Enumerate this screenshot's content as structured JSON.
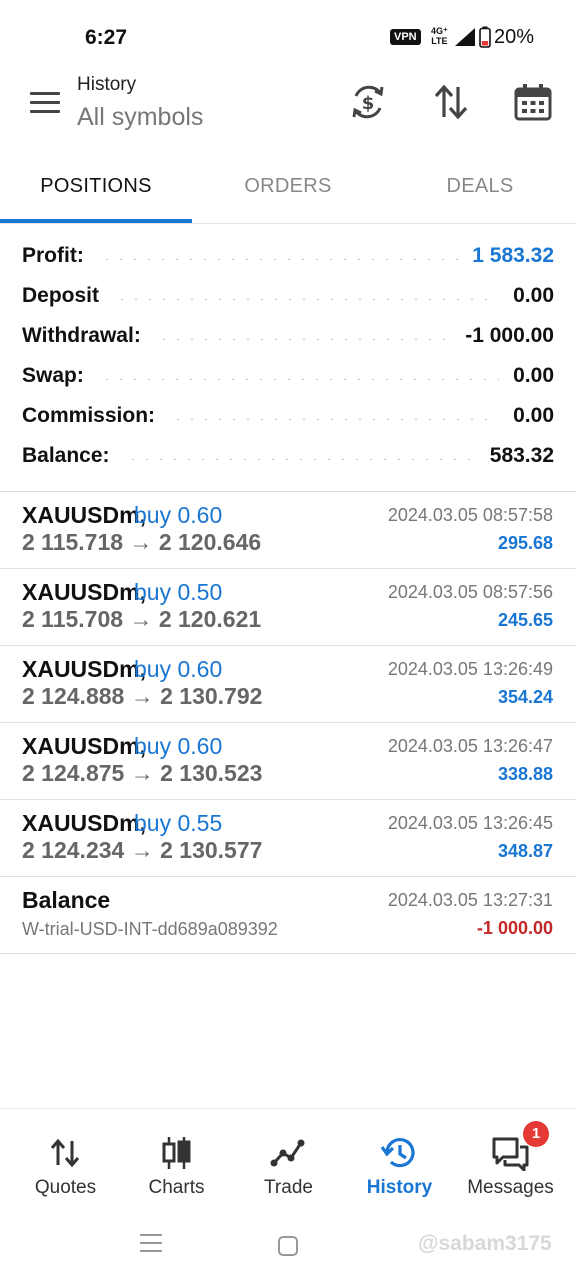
{
  "status_bar": {
    "time": "6:27",
    "vpn": "VPN",
    "network_top": "4G⁺",
    "network_bottom": "LTE",
    "battery": "20%"
  },
  "header": {
    "title": "History",
    "subtitle": "All symbols",
    "icons": [
      "currency-refresh-icon",
      "sort-icon",
      "calendar-icon"
    ]
  },
  "tabs": [
    {
      "label": "POSITIONS",
      "active": true
    },
    {
      "label": "ORDERS",
      "active": false
    },
    {
      "label": "DEALS",
      "active": false
    }
  ],
  "summary": {
    "profit": {
      "label": "Profit:",
      "value": "1 583.32"
    },
    "deposit": {
      "label": "Deposit",
      "value": "0.00"
    },
    "withdrawal": {
      "label": "Withdrawal:",
      "value": "-1 000.00"
    },
    "swap": {
      "label": "Swap:",
      "value": "0.00"
    },
    "commission": {
      "label": "Commission:",
      "value": "0.00"
    },
    "balance": {
      "label": "Balance:",
      "value": "583.32"
    }
  },
  "deals": [
    {
      "symbol": "XAUUSDm,",
      "side": "buy 0.60",
      "prices": "2 115.718 → 2 120.646",
      "time": "2024.03.05 08:57:58",
      "profit": "295.68"
    },
    {
      "symbol": "XAUUSDm,",
      "side": "buy 0.50",
      "prices": "2 115.708 → 2 120.621",
      "time": "2024.03.05 08:57:56",
      "profit": "245.65"
    },
    {
      "symbol": "XAUUSDm,",
      "side": "buy 0.60",
      "prices": "2 124.888 → 2 130.792",
      "time": "2024.03.05 13:26:49",
      "profit": "354.24"
    },
    {
      "symbol": "XAUUSDm,",
      "side": "buy 0.60",
      "prices": "2 124.875 → 2 130.523",
      "time": "2024.03.05 13:26:47",
      "profit": "338.88"
    },
    {
      "symbol": "XAUUSDm,",
      "side": "buy 0.55",
      "prices": "2 124.234 → 2 130.577",
      "time": "2024.03.05 13:26:45",
      "profit": "348.87"
    }
  ],
  "balance_entry": {
    "title": "Balance",
    "comment": "W-trial-USD-INT-dd689a089392",
    "time": "2024.03.05 13:27:31",
    "amount": "-1 000.00"
  },
  "bottom_nav": [
    {
      "label": "Quotes",
      "icon": "quotes-icon",
      "active": false
    },
    {
      "label": "Charts",
      "icon": "charts-icon",
      "active": false
    },
    {
      "label": "Trade",
      "icon": "trade-icon",
      "active": false
    },
    {
      "label": "History",
      "icon": "history-icon",
      "active": true
    },
    {
      "label": "Messages",
      "icon": "messages-icon",
      "active": false,
      "badge": "1"
    }
  ],
  "watermark": "@sabam3175",
  "colors": {
    "accent": "#1976d2",
    "negative": "#c62828",
    "badge": "#e53935"
  }
}
